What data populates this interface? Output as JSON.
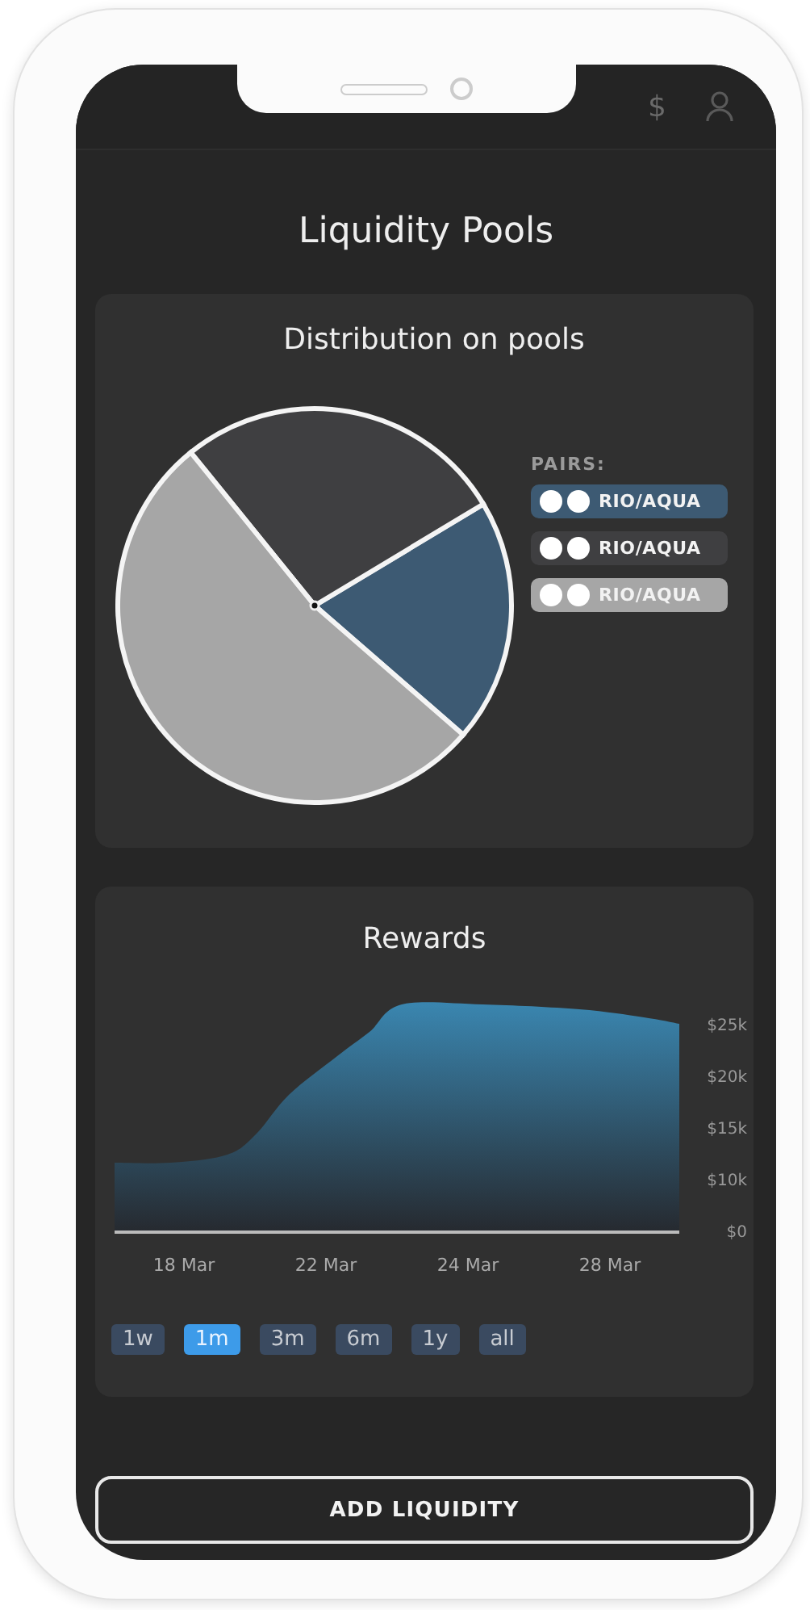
{
  "header": {
    "currency_symbol": "$"
  },
  "title": "Liquidity Pools",
  "distribution": {
    "title": "Distribution on pools",
    "legend_title": "PAIRS:",
    "pairs": [
      {
        "label": "RIO/AQUA",
        "color": "#3d5a73"
      },
      {
        "label": "RIO/AQUA",
        "color": "#3f3f41"
      },
      {
        "label": "RIO/AQUA",
        "color": "#a6a6a6"
      }
    ]
  },
  "rewards": {
    "title": "Rewards",
    "y_axis_labels": [
      "$25k",
      "$20k",
      "$15k",
      "$10k",
      "$0"
    ],
    "x_axis_labels": [
      "18 Mar",
      "22 Mar",
      "24 Mar",
      "28 Mar"
    ],
    "ranges": [
      {
        "label": "1w",
        "selected": false
      },
      {
        "label": "1m",
        "selected": true
      },
      {
        "label": "3m",
        "selected": false
      },
      {
        "label": "6m",
        "selected": false
      },
      {
        "label": "1y",
        "selected": false
      },
      {
        "label": "all",
        "selected": false
      }
    ]
  },
  "action": "ADD LIQUIDITY"
}
